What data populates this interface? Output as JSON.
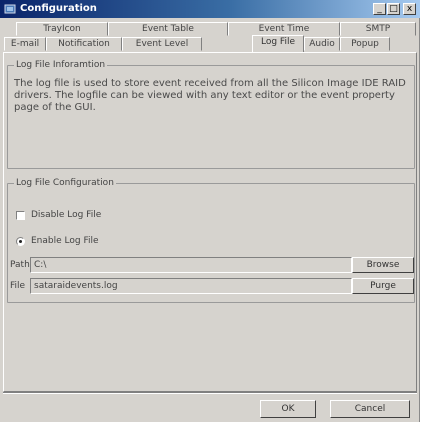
{
  "window": {
    "title": "Configuration",
    "minimize_glyph": "_",
    "maximize_glyph": "□",
    "close_glyph": "x"
  },
  "tabs_back": [
    {
      "label": "TrayIcon"
    },
    {
      "label": "Event Table"
    },
    {
      "label": "Event Time"
    },
    {
      "label": "SMTP"
    }
  ],
  "tabs_front": [
    {
      "label": "E-mail"
    },
    {
      "label": "Notification"
    },
    {
      "label": "Event Level"
    },
    {
      "label": "Log File"
    },
    {
      "label": "Audio"
    },
    {
      "label": "Popup"
    }
  ],
  "info_group": {
    "title": "Log File Inforamtion",
    "text": "The log file is used to store event received from all the Silicon Image IDE RAID drivers. The logfile can be viewed with any text editor or the event property page of the GUI."
  },
  "config_group": {
    "title": "Log File Configuration",
    "disable_label": "Disable Log File",
    "enable_label": "Enable Log File",
    "path_label": "Path",
    "path_value": "C:\\",
    "browse_label": "Browse",
    "file_label": "File",
    "file_value": "sataraidevents.log",
    "purge_label": "Purge"
  },
  "footer": {
    "ok_label": "OK",
    "cancel_label": "Cancel"
  }
}
